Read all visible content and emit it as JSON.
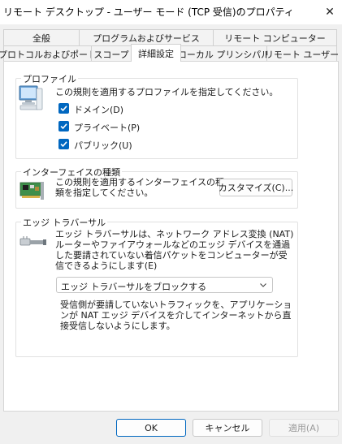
{
  "window": {
    "title": "リモート デスクトップ - ユーザー モード (TCP 受信)のプロパティ",
    "close_glyph": "✕"
  },
  "tabs": {
    "row_top": [
      {
        "label": "全般"
      },
      {
        "label": "プログラムおよびサービス"
      },
      {
        "label": "リモート コンピューター"
      }
    ],
    "row_bottom": [
      {
        "label": "プロトコルおよびポート"
      },
      {
        "label": "スコープ"
      },
      {
        "label": "詳細設定",
        "active": true
      },
      {
        "label": "ローカル プリンシパル"
      },
      {
        "label": "リモート ユーザー"
      }
    ]
  },
  "profiles": {
    "group_title": "プロファイル",
    "description": "この規則を適用するプロファイルを指定してください。",
    "icon": "computer-icon",
    "items": [
      {
        "label": "ドメイン(D)",
        "checked": true
      },
      {
        "label": "プライベート(P)",
        "checked": true
      },
      {
        "label": "パブリック(U)",
        "checked": true
      }
    ]
  },
  "interface_types": {
    "group_title": "インターフェイスの種類",
    "description": "この規則を適用するインターフェイスの種類を指定してください。",
    "icon": "network-card-icon",
    "customize_label": "カスタマイズ(C)..."
  },
  "edge_traversal": {
    "group_title": "エッジ トラバーサル",
    "description": "エッジ トラバーサルは、ネットワーク アドレス変換 (NAT) ルーターやファイアウォールなどのエッジ デバイスを通過した要請されていない着信パケットをコンピューターが受信できるようにします(E)",
    "icon": "network-cable-icon",
    "selected": "エッジ トラバーサルをブロックする",
    "note": "受信側が要請していないトラフィックを、アプリケーションが NAT エッジ デバイスを介してインターネットから直接受信しないようにします。"
  },
  "footer": {
    "ok_label": "OK",
    "cancel_label": "キャンセル",
    "apply_label": "適用(A)"
  },
  "colors": {
    "accent": "#0067c0"
  }
}
